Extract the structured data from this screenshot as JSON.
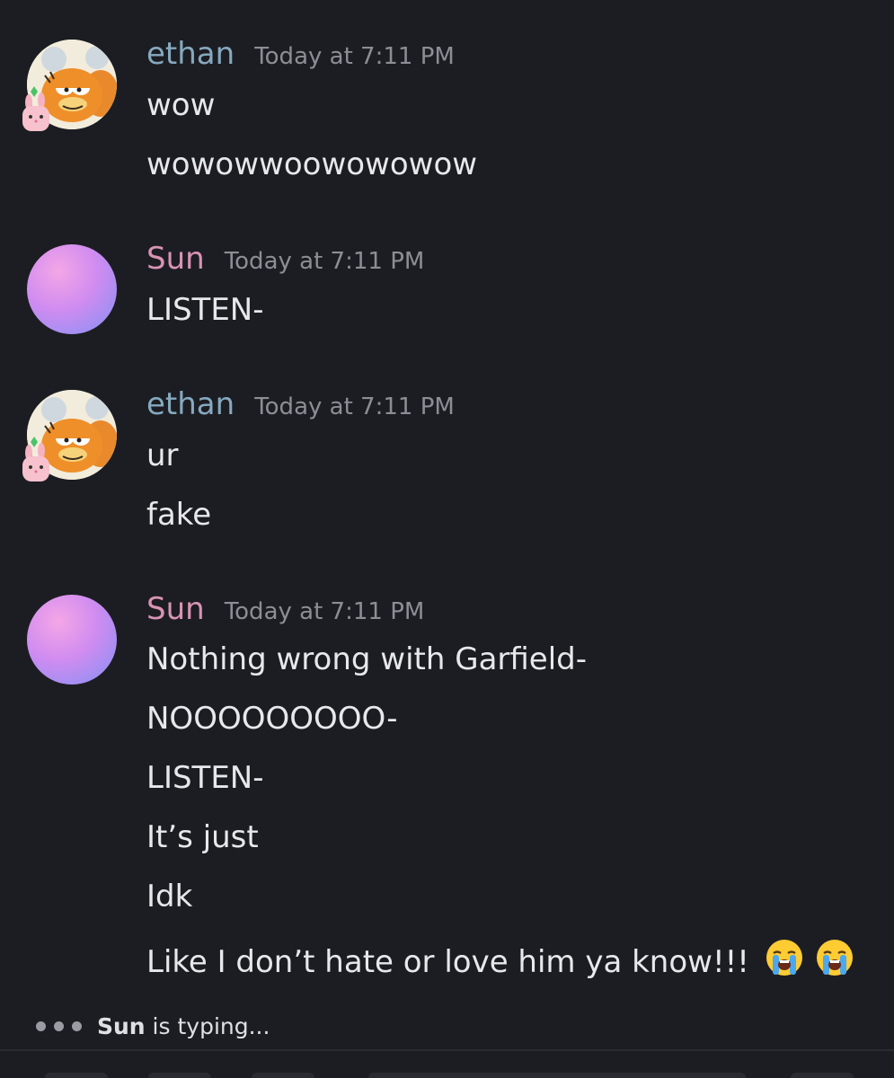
{
  "messages": [
    {
      "author": "ethan",
      "timestamp": "Today at 7:11 PM",
      "lines": [
        "wow",
        "wowowwoowowowow"
      ]
    },
    {
      "author": "Sun",
      "timestamp": "Today at 7:11 PM",
      "lines": [
        "LISTEN-"
      ]
    },
    {
      "author": "ethan",
      "timestamp": "Today at 7:11 PM",
      "lines": [
        "ur",
        "fake"
      ]
    },
    {
      "author": "Sun",
      "timestamp": "Today at 7:11 PM",
      "lines": [
        "Nothing wrong with Garfield-",
        "NOOOOOOOOO-",
        "LISTEN-",
        "It’s just",
        "Idk",
        "Like I don’t hate or love him ya know!!!"
      ]
    }
  ],
  "emojis": [
    "loudly-crying-face",
    "loudly-crying-face"
  ],
  "typing": {
    "user": "Sun",
    "suffix": " is typing..."
  },
  "colors": {
    "background": "#1c1d22",
    "ethan_name": "#86a9bf",
    "sun_name": "#d993b5",
    "timestamp": "#8c8e96"
  }
}
